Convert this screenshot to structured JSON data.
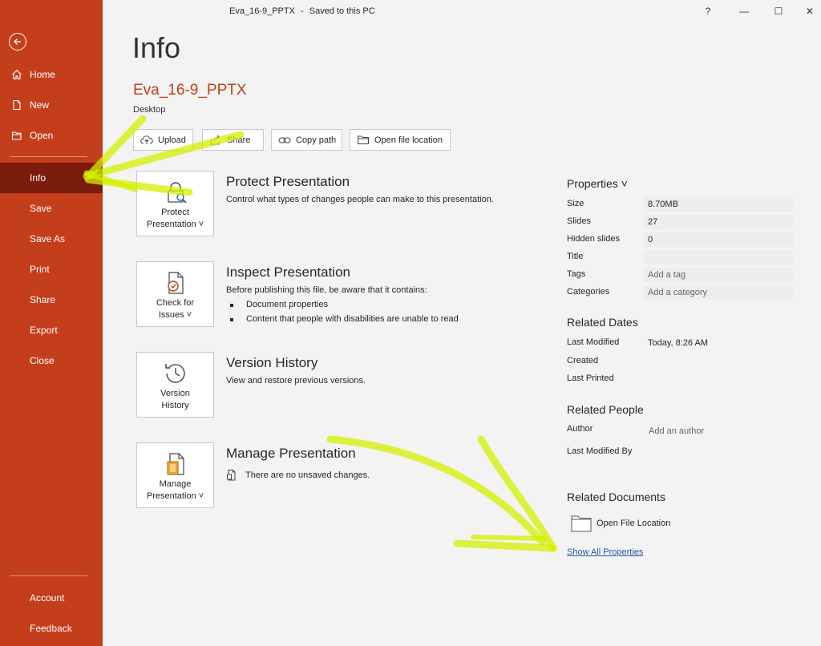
{
  "titlebar": {
    "document": "Eva_16-9_PPTX",
    "separator": "-",
    "status": "Saved to this PC",
    "help": "?",
    "minimize": "—",
    "maximize": "☐",
    "close": "✕"
  },
  "sidebar": {
    "items": [
      {
        "label": "Home",
        "icon": "home-icon"
      },
      {
        "label": "New",
        "icon": "new-document-icon"
      },
      {
        "label": "Open",
        "icon": "folder-open-icon"
      },
      {
        "label": "Info",
        "active": true
      },
      {
        "label": "Save"
      },
      {
        "label": "Save As"
      },
      {
        "label": "Print"
      },
      {
        "label": "Share"
      },
      {
        "label": "Export"
      },
      {
        "label": "Close"
      }
    ],
    "bottom": [
      {
        "label": "Account"
      },
      {
        "label": "Feedback"
      }
    ]
  },
  "main": {
    "title": "Info",
    "file_name": "Eva_16-9_PPTX",
    "location": "Desktop",
    "actions": [
      {
        "label": "Upload",
        "icon": "cloud-upload-icon"
      },
      {
        "label": "Share",
        "icon": "share-icon"
      },
      {
        "label": "Copy path",
        "icon": "link-icon"
      },
      {
        "label": "Open file location",
        "icon": "folder-icon"
      }
    ],
    "sections": [
      {
        "card_label": "Protect Presentation ˅",
        "card_line1": "Protect",
        "card_line2": "Presentation ˅",
        "title": "Protect Presentation",
        "desc": "Control what types of changes people can make to this presentation."
      },
      {
        "card_line1": "Check for",
        "card_line2": "Issues ˅",
        "title": "Inspect Presentation",
        "desc": "Before publishing this file, be aware that it contains:",
        "bullets": [
          "Document properties",
          "Content that people with disabilities are unable to read"
        ]
      },
      {
        "card_line1": "Version",
        "card_line2": "History",
        "title": "Version History",
        "desc": "View and restore previous versions."
      },
      {
        "card_line1": "Manage",
        "card_line2": "Presentation ˅",
        "title": "Manage Presentation",
        "desc": "There are no unsaved changes."
      }
    ]
  },
  "properties": {
    "header": "Properties ˅",
    "rows": [
      {
        "label": "Size",
        "value": "8.70MB"
      },
      {
        "label": "Slides",
        "value": "27"
      },
      {
        "label": "Hidden slides",
        "value": "0"
      },
      {
        "label": "Title",
        "value": ""
      },
      {
        "label": "Tags",
        "value": "Add a tag"
      },
      {
        "label": "Categories",
        "value": "Add a category"
      }
    ],
    "related_dates": {
      "header": "Related Dates",
      "rows": [
        {
          "label": "Last Modified",
          "value": "Today, 8:26 AM"
        },
        {
          "label": "Created",
          "value": ""
        },
        {
          "label": "Last Printed",
          "value": ""
        }
      ]
    },
    "related_people": {
      "header": "Related People",
      "rows": [
        {
          "label": "Author",
          "value": "Add an author"
        },
        {
          "label": "Last Modified By",
          "value": ""
        }
      ]
    },
    "related_documents": {
      "header": "Related Documents",
      "open_file_location": "Open File Location"
    },
    "show_all": "Show All Properties"
  },
  "colors": {
    "accent": "#c43e1c",
    "active_nav": "#791b0d",
    "link": "#2b579a",
    "highlighter": "#d4f000"
  }
}
